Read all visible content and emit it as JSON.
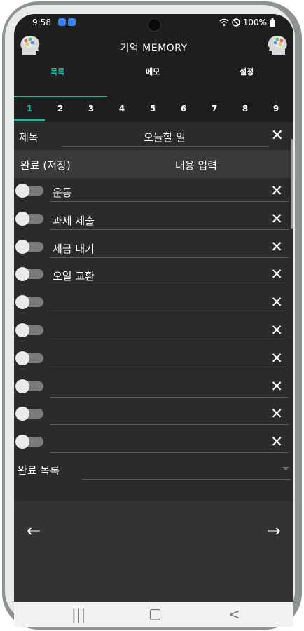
{
  "status": {
    "time": "9:58",
    "battery": "100%"
  },
  "app": {
    "title": "기억  MEMORY"
  },
  "tabs": [
    {
      "label": "목록"
    },
    {
      "label": "메모"
    },
    {
      "label": "설정"
    }
  ],
  "pages": [
    "1",
    "2",
    "3",
    "4",
    "5",
    "6",
    "7",
    "8",
    "9"
  ],
  "title_field": {
    "label": "제목",
    "value": "오늘할 일"
  },
  "list_header": {
    "left": "완료 (저장)",
    "center": "내용 입력"
  },
  "items": [
    {
      "text": "운동"
    },
    {
      "text": "과제 제출"
    },
    {
      "text": "세금 내기"
    },
    {
      "text": "오일 교환"
    },
    {
      "text": ""
    },
    {
      "text": ""
    },
    {
      "text": ""
    },
    {
      "text": ""
    },
    {
      "text": ""
    },
    {
      "text": ""
    }
  ],
  "completed": {
    "label": "완료 목록"
  },
  "colors": {
    "accent": "#2bb3a0",
    "background": "#2b2b2b"
  }
}
